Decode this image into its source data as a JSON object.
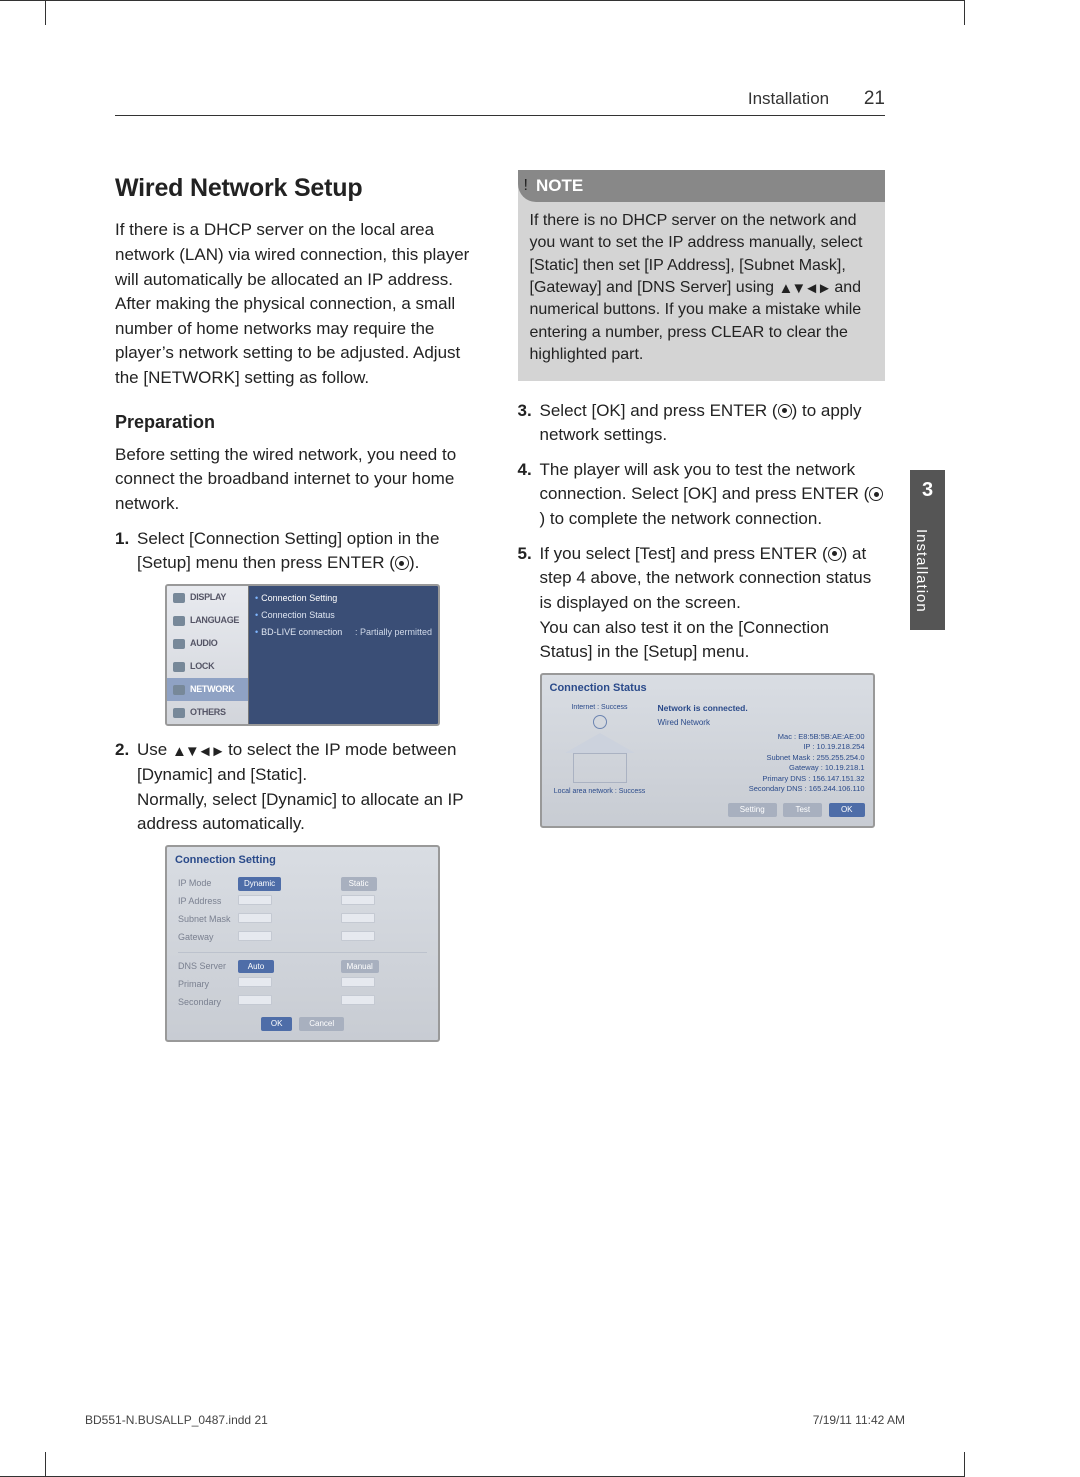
{
  "header": {
    "section": "Installation",
    "page": "21"
  },
  "sidetab": {
    "num": "3",
    "label": "Installation"
  },
  "h2": "Wired Network Setup",
  "intro": "If there is a DHCP server on the local area network (LAN) via wired connection, this player will automatically be allocated an IP address. After making the physical connection, a small number of home networks may require the player’s network setting to be adjusted. Adjust the [NETWORK] setting as follow.",
  "prep_h": "Preparation",
  "prep_p": "Before setting the wired network, you need to connect the broadband internet to your home network.",
  "step1a": "Select [Connection Setting] option in the [Setup] menu then press ENTER (",
  "step1b": ").",
  "step2a": "Use ",
  "step2b": " to select the IP mode between [Dynamic] and [Static].",
  "step2c": "Normally, select [Dynamic] to allocate an IP address automatically.",
  "note_h": "NOTE",
  "note_a": "If there is no DHCP server on the network and you want to set the IP address manually, select [Static] then set [IP Address], [Subnet Mask], [Gateway] and [DNS Server] using ",
  "note_b": " and numerical buttons. If you make a mistake while entering a number, press CLEAR to clear the highlighted part.",
  "step3a": "Select [OK] and press ENTER (",
  "step3b": ") to apply network settings.",
  "step4a": "The player will ask you to test the network connection. Select [OK] and press ENTER (",
  "step4b": ") to complete the network connection.",
  "step5a": "If you select [Test] and press ENTER (",
  "step5b": ") at step 4 above, the network connection status is displayed on the screen.",
  "step5c": "You can also test it on the [Connection Status] in the [Setup] menu.",
  "scr1": {
    "menu": [
      "DISPLAY",
      "LANGUAGE",
      "AUDIO",
      "LOCK",
      "NETWORK",
      "OTHERS"
    ],
    "sel_index": 4,
    "opts": [
      {
        "label": "Connection Setting",
        "sel": true
      },
      {
        "label": "Connection Status"
      },
      {
        "label": "BD-LIVE connection",
        "val": ": Partially permitted"
      }
    ]
  },
  "scr2": {
    "title": "Connection Setting",
    "ipmode": "IP Mode",
    "dynamic": "Dynamic",
    "static": "Static",
    "ipaddr": "IP Address",
    "mask": "Subnet Mask",
    "gw": "Gateway",
    "dns": "DNS Server",
    "auto": "Auto",
    "manual": "Manual",
    "pri": "Primary",
    "sec": "Secondary",
    "ok": "OK",
    "cancel": "Cancel"
  },
  "scr3": {
    "title": "Connection Status",
    "inet": "Internet : Success",
    "lan": "Local area network : Success",
    "conn": "Network is connected.",
    "wired": "Wired Network",
    "rows": [
      "Mac : E8:5B:5B:AE:AE:00",
      "IP : 10.19.218.254",
      "Subnet Mask : 255.255.254.0",
      "Gateway : 10.19.218.1",
      "Primary DNS : 156.147.151.32",
      "Secondary DNS : 165.244.106.110"
    ],
    "setting": "Setting",
    "test": "Test",
    "ok": "OK"
  },
  "footer": {
    "file": "BD551-N.BUSALLP_0487.indd   21",
    "date": "7/19/11   11:42 AM"
  }
}
